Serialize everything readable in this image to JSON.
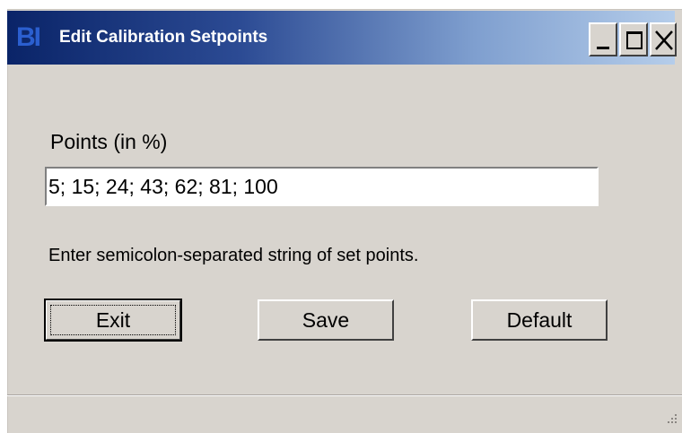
{
  "window": {
    "icon_text": "BI",
    "title": "Edit Calibration Setpoints",
    "minimize_icon": "minimize-icon",
    "maximize_icon": "maximize-icon",
    "close_icon": "close-icon"
  },
  "form": {
    "points_label": "Points (in %)",
    "points_value": "5; 15; 24; 43; 62; 81; 100",
    "help_text": "Enter semicolon-separated string of set points."
  },
  "buttons": {
    "exit": "Exit",
    "save": "Save",
    "default": "Default"
  },
  "colors": {
    "titlebar_start": "#0a2468",
    "titlebar_end": "#b5cdea",
    "dialog_bg": "#d8d4ce"
  }
}
